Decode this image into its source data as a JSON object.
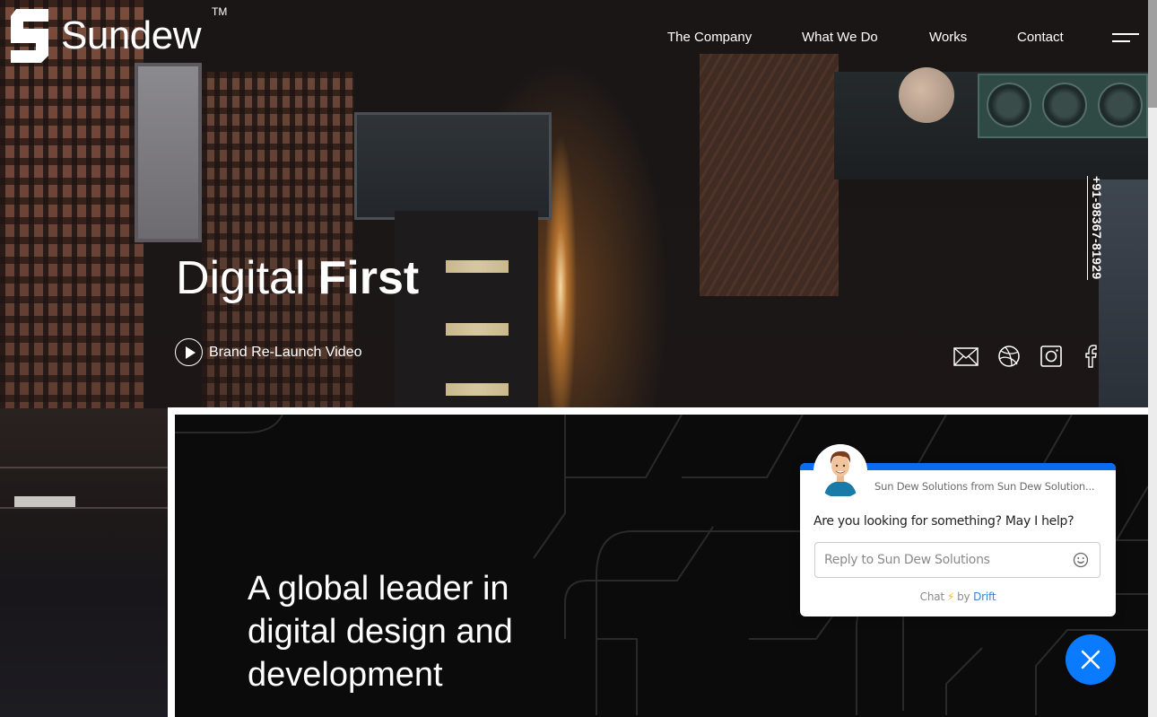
{
  "brand": {
    "name": "Sundew",
    "trademark": "TM"
  },
  "nav": {
    "items": [
      {
        "label": "The Company"
      },
      {
        "label": "What We Do"
      },
      {
        "label": "Works"
      },
      {
        "label": "Contact"
      }
    ],
    "menu_icon": "hamburger-icon"
  },
  "hero": {
    "title_light": "Digital",
    "title_bold": "First",
    "video_link": "Brand Re-Launch Video",
    "phone": "+91-98367-81929",
    "socials": [
      {
        "name": "email",
        "icon": "envelope-icon"
      },
      {
        "name": "dribbble",
        "icon": "dribbble-icon"
      },
      {
        "name": "instagram",
        "icon": "instagram-icon"
      },
      {
        "name": "facebook",
        "icon": "facebook-icon"
      }
    ]
  },
  "panel": {
    "heading_lines": [
      "A global leader in",
      "digital design and",
      "development"
    ]
  },
  "chat": {
    "sender": "Sun Dew Solutions from Sun Dew Solution...",
    "message": "Are you looking for something? May I help?",
    "input_placeholder": "Reply to Sun Dew Solutions",
    "footer_chat": "Chat",
    "footer_bolt": "⚡",
    "footer_by": "by",
    "footer_brand": "Drift",
    "accent_color": "#0a6cf0"
  }
}
